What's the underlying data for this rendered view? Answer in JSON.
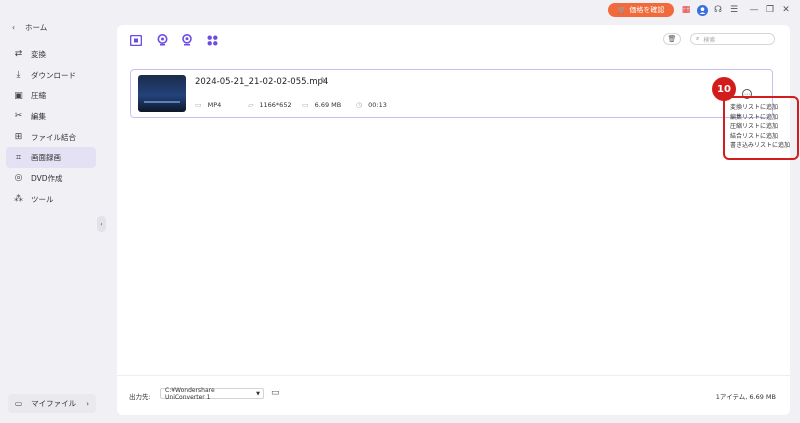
{
  "topbar": {
    "price_button": "価格を確認",
    "icons": [
      "gift-icon",
      "user-icon",
      "headset-icon",
      "menu-icon",
      "minimize-icon",
      "restore-icon",
      "close-icon"
    ]
  },
  "sidebar": {
    "back_label": "ホーム",
    "items": [
      {
        "label": "変換",
        "icon": "convert-icon"
      },
      {
        "label": "ダウンロード",
        "icon": "download-icon"
      },
      {
        "label": "圧縮",
        "icon": "compress-icon"
      },
      {
        "label": "編集",
        "icon": "scissors-icon"
      },
      {
        "label": "ファイル結合",
        "icon": "merge-icon"
      },
      {
        "label": "画面録画",
        "icon": "screen-record-icon",
        "active": true
      },
      {
        "label": "DVD作成",
        "icon": "dvd-icon"
      },
      {
        "label": "ツール",
        "icon": "tools-icon"
      }
    ],
    "my_files": "マイファイル"
  },
  "toolbar": {
    "search_placeholder": "検索"
  },
  "file": {
    "name": "2024-05-21_21-02-02-055.mp4",
    "format": "MP4",
    "resolution": "1166*652",
    "size": "6.69 MB",
    "duration": "00:13"
  },
  "annotation": {
    "badge": "10",
    "menu_items": [
      "変換リストに追加",
      "編集リストに追加",
      "圧縮リストに追加",
      "結合リストに追加",
      "書き込みリストに追加"
    ]
  },
  "footer": {
    "output_label": "出力先:",
    "output_path": "C:¥Wondershare UniConverter 1",
    "summary": "1アイテム, 6.69 MB"
  },
  "colors": {
    "accent": "#6c4de4",
    "price": "#f06a3b",
    "annotation": "#d31d1d"
  }
}
